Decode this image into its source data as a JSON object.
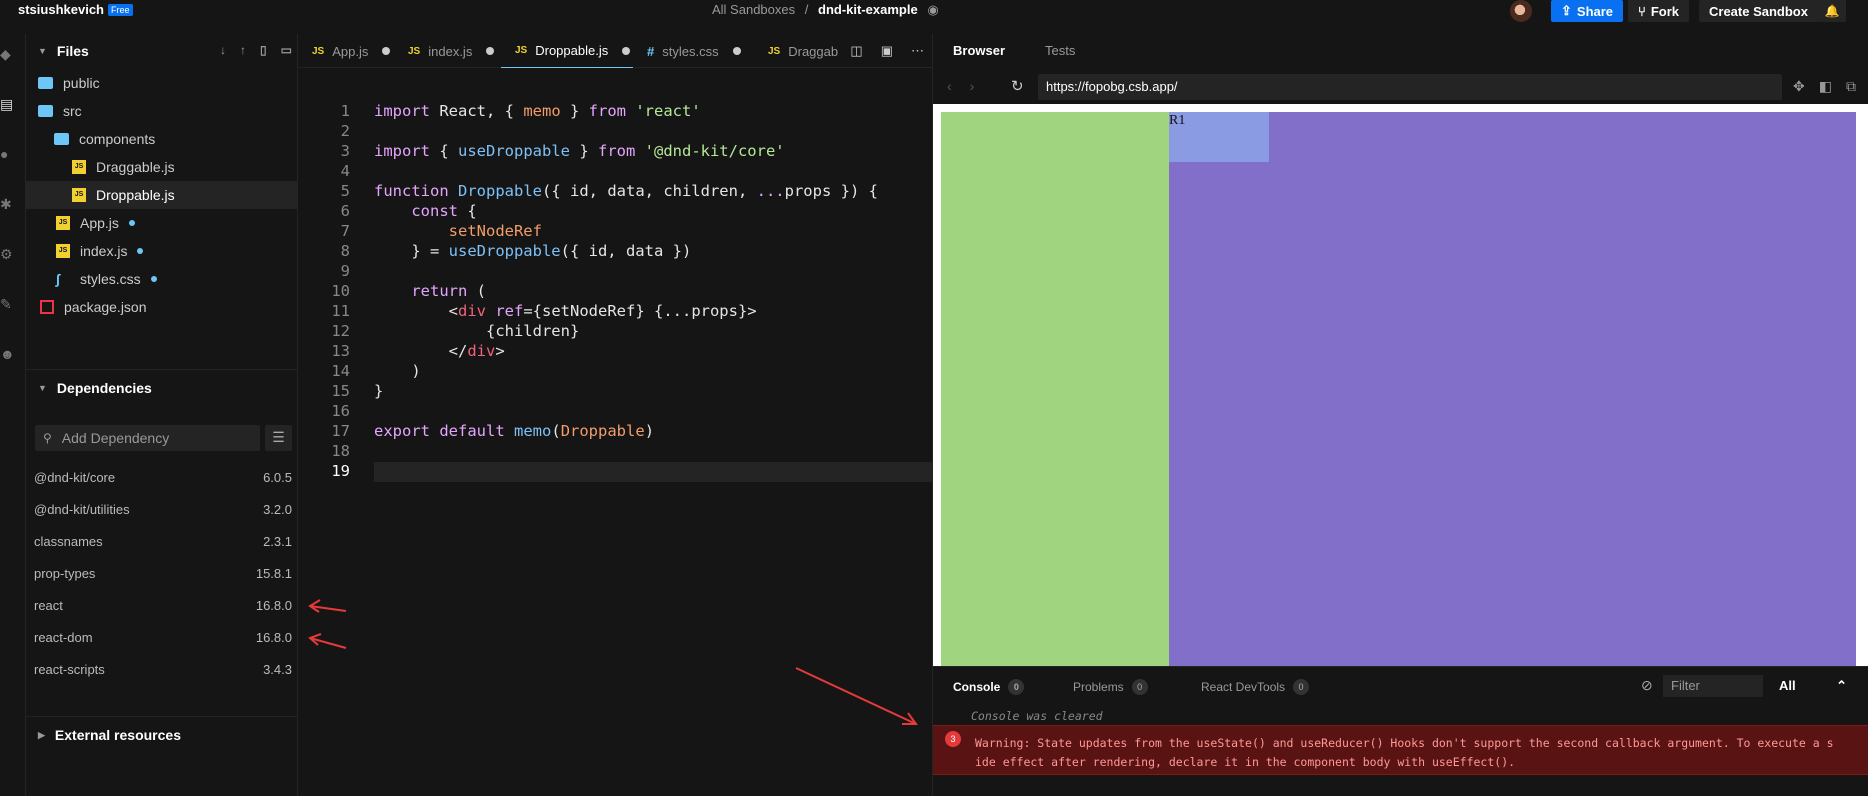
{
  "topbar": {
    "username": "stsiushkevich",
    "plan_badge": "Free",
    "breadcrumb_root": "All Sandboxes",
    "breadcrumb_sep": "/",
    "sandbox_name": "dnd-kit-example",
    "share_label": "Share",
    "fork_label": "Fork",
    "create_label": "Create Sandbox"
  },
  "files": {
    "title": "Files",
    "tree": [
      {
        "label": "public",
        "kind": "folder"
      },
      {
        "label": "src",
        "kind": "folder"
      },
      {
        "label": "components",
        "kind": "folder"
      },
      {
        "label": "Draggable.js",
        "kind": "js"
      },
      {
        "label": "Droppable.js",
        "kind": "js"
      },
      {
        "label": "App.js",
        "kind": "js"
      },
      {
        "label": "index.js",
        "kind": "js"
      },
      {
        "label": "styles.css",
        "kind": "css"
      },
      {
        "label": "package.json",
        "kind": "json"
      }
    ]
  },
  "dependencies": {
    "title": "Dependencies",
    "add_placeholder": "Add Dependency",
    "items": [
      {
        "name": "@dnd-kit/core",
        "version": "6.0.5"
      },
      {
        "name": "@dnd-kit/utilities",
        "version": "3.2.0"
      },
      {
        "name": "classnames",
        "version": "2.3.1"
      },
      {
        "name": "prop-types",
        "version": "15.8.1"
      },
      {
        "name": "react",
        "version": "16.8.0"
      },
      {
        "name": "react-dom",
        "version": "16.8.0"
      },
      {
        "name": "react-scripts",
        "version": "3.4.3"
      }
    ]
  },
  "external_resources": {
    "title": "External resources"
  },
  "editor": {
    "tabs": [
      {
        "label": "App.js",
        "icon": "JS"
      },
      {
        "label": "index.js",
        "icon": "JS"
      },
      {
        "label": "Droppable.js",
        "icon": "JS"
      },
      {
        "label": "styles.css",
        "icon": "#"
      },
      {
        "label": "Draggab",
        "icon": "JS"
      }
    ],
    "line_numbers": [
      "1",
      "2",
      "3",
      "4",
      "5",
      "6",
      "7",
      "8",
      "9",
      "10",
      "11",
      "12",
      "13",
      "14",
      "15",
      "16",
      "17",
      "18",
      "19"
    ]
  },
  "browser": {
    "tab_browser": "Browser",
    "tab_tests": "Tests",
    "url": "https://fopobg.csb.app/",
    "preview_label": "R1"
  },
  "console": {
    "tab_console": "Console",
    "console_count": "0",
    "tab_problems": "Problems",
    "problems_count": "0",
    "tab_devtools": "React DevTools",
    "devtools_count": "0",
    "filter_placeholder": "Filter",
    "level": "All",
    "cleared_msg": "Console was cleared",
    "warning_count": "3",
    "warning_text": "Warning: State updates from the useState() and useReducer() Hooks don't support the second callback argument. To execute a s\nide effect after rendering, declare it in the component body with useEffect()."
  },
  "colors": {
    "accent": "#0971f1",
    "preview_green": "#a1d47e",
    "preview_purple": "#826fc9",
    "preview_r1": "#8a9be3",
    "warning_bg": "#5a1313",
    "annotation_arrow": "#e53a3a"
  }
}
